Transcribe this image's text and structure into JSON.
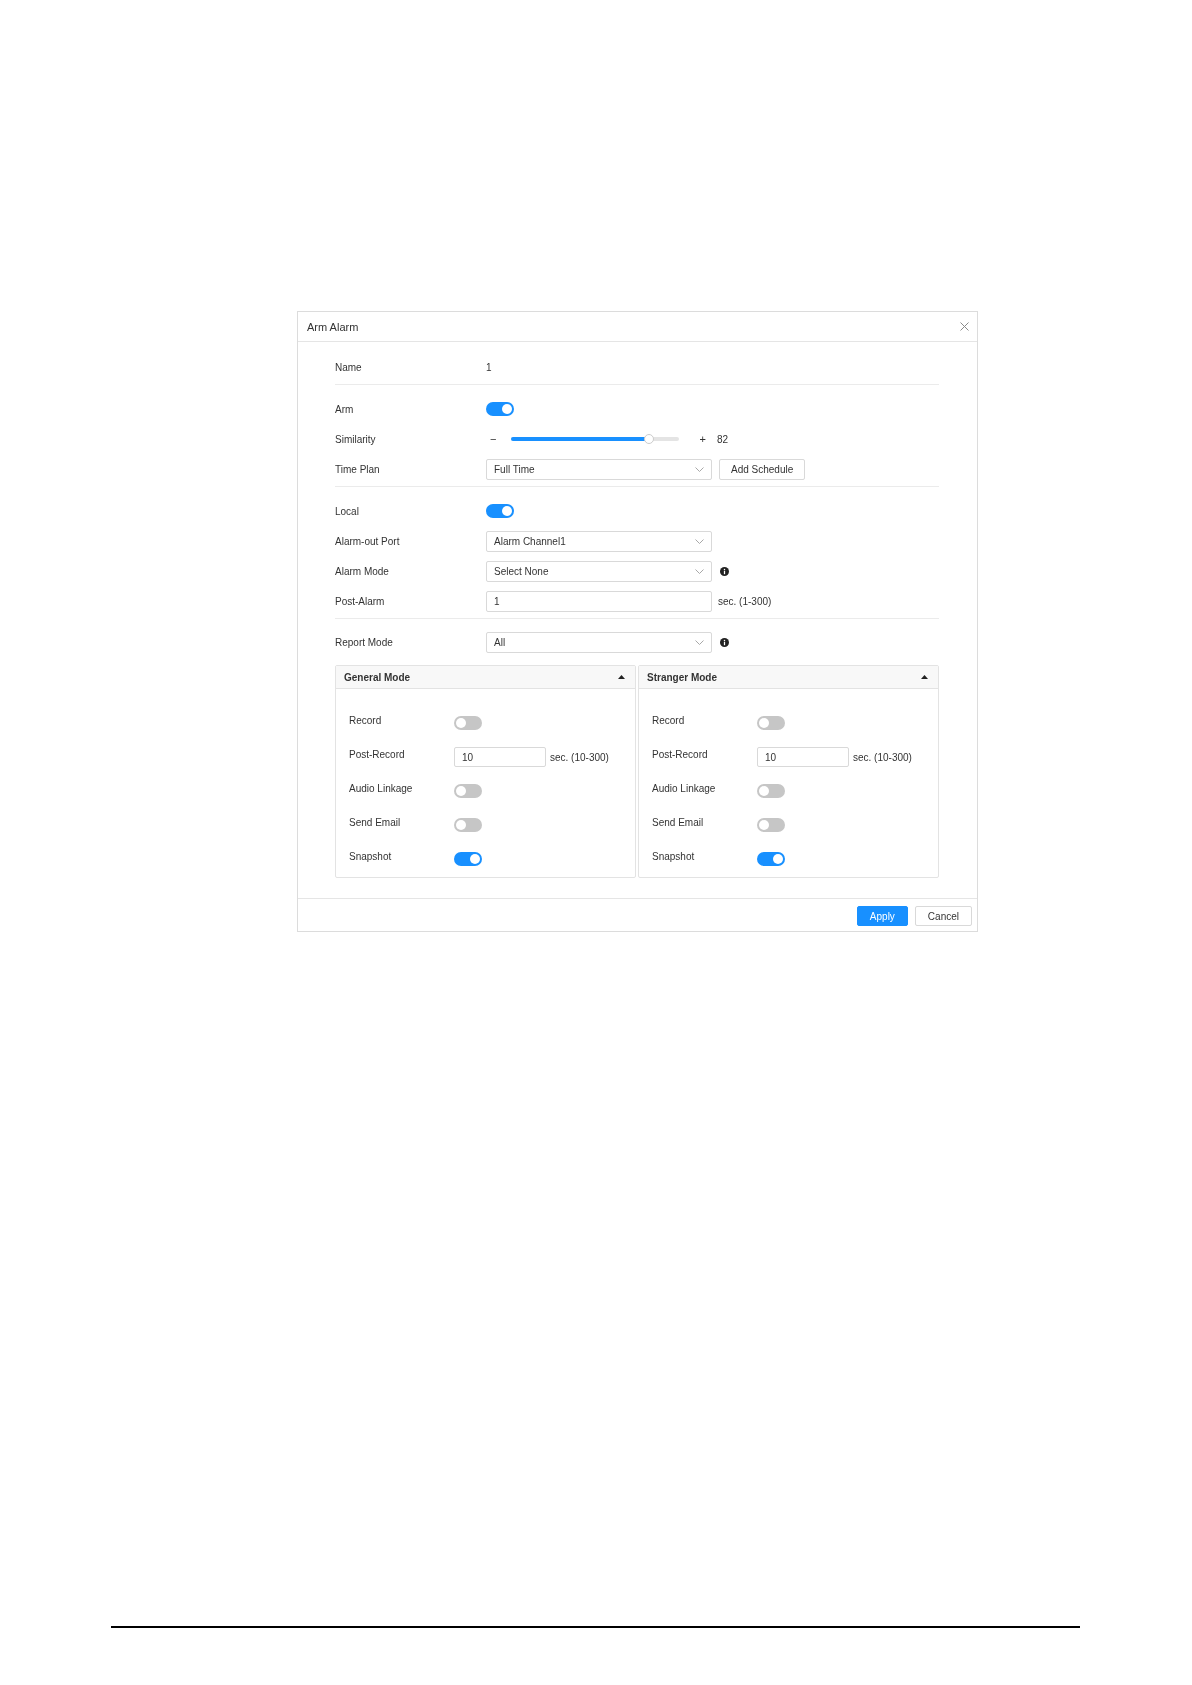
{
  "dialog": {
    "title": "Arm Alarm",
    "sections": [
      {
        "rows": [
          {
            "kind": "text",
            "label": "Name",
            "value": "1"
          }
        ]
      },
      {
        "rows": [
          {
            "kind": "toggle",
            "label": "Arm",
            "on": true
          },
          {
            "kind": "slider",
            "label": "Similarity",
            "decrease": "−",
            "increase": "+",
            "level": 0.82,
            "reading": "82"
          },
          {
            "kind": "select",
            "label": "Time Plan",
            "value": "Full Time",
            "button": "Add Schedule"
          }
        ]
      },
      {
        "rows": [
          {
            "kind": "toggle",
            "label": "Local",
            "on": true
          },
          {
            "kind": "select",
            "label": "Alarm-out Port",
            "value": "Alarm Channel1"
          },
          {
            "kind": "select",
            "label": "Alarm Mode",
            "value": "Select None",
            "info": true
          },
          {
            "kind": "input",
            "label": "Post-Alarm",
            "value": "1",
            "suffix": "sec. (1-300)"
          }
        ]
      },
      {
        "rows": [
          {
            "kind": "select",
            "label": "Report Mode",
            "value": "All",
            "info": true
          }
        ]
      }
    ],
    "panels": [
      {
        "title": "General Mode",
        "expanded": true,
        "rows": [
          {
            "kind": "toggle",
            "label": "Record",
            "on": false
          },
          {
            "kind": "input",
            "label": "Post-Record",
            "value": "10",
            "suffix": "sec. (10-300)"
          },
          {
            "kind": "toggle",
            "label": "Audio Linkage",
            "on": false
          },
          {
            "kind": "toggle",
            "label": "Send Email",
            "on": false
          },
          {
            "kind": "toggle",
            "label": "Snapshot",
            "on": true
          }
        ]
      },
      {
        "title": "Stranger Mode",
        "expanded": true,
        "rows": [
          {
            "kind": "toggle",
            "label": "Record",
            "on": false
          },
          {
            "kind": "input",
            "label": "Post-Record",
            "value": "10",
            "suffix": "sec. (10-300)"
          },
          {
            "kind": "toggle",
            "label": "Audio Linkage",
            "on": false
          },
          {
            "kind": "toggle",
            "label": "Send Email",
            "on": false
          },
          {
            "kind": "toggle",
            "label": "Snapshot",
            "on": true
          }
        ]
      }
    ],
    "buttons": [
      {
        "kind": "primary",
        "label": "Apply"
      },
      {
        "kind": "default",
        "label": "Cancel"
      }
    ]
  }
}
